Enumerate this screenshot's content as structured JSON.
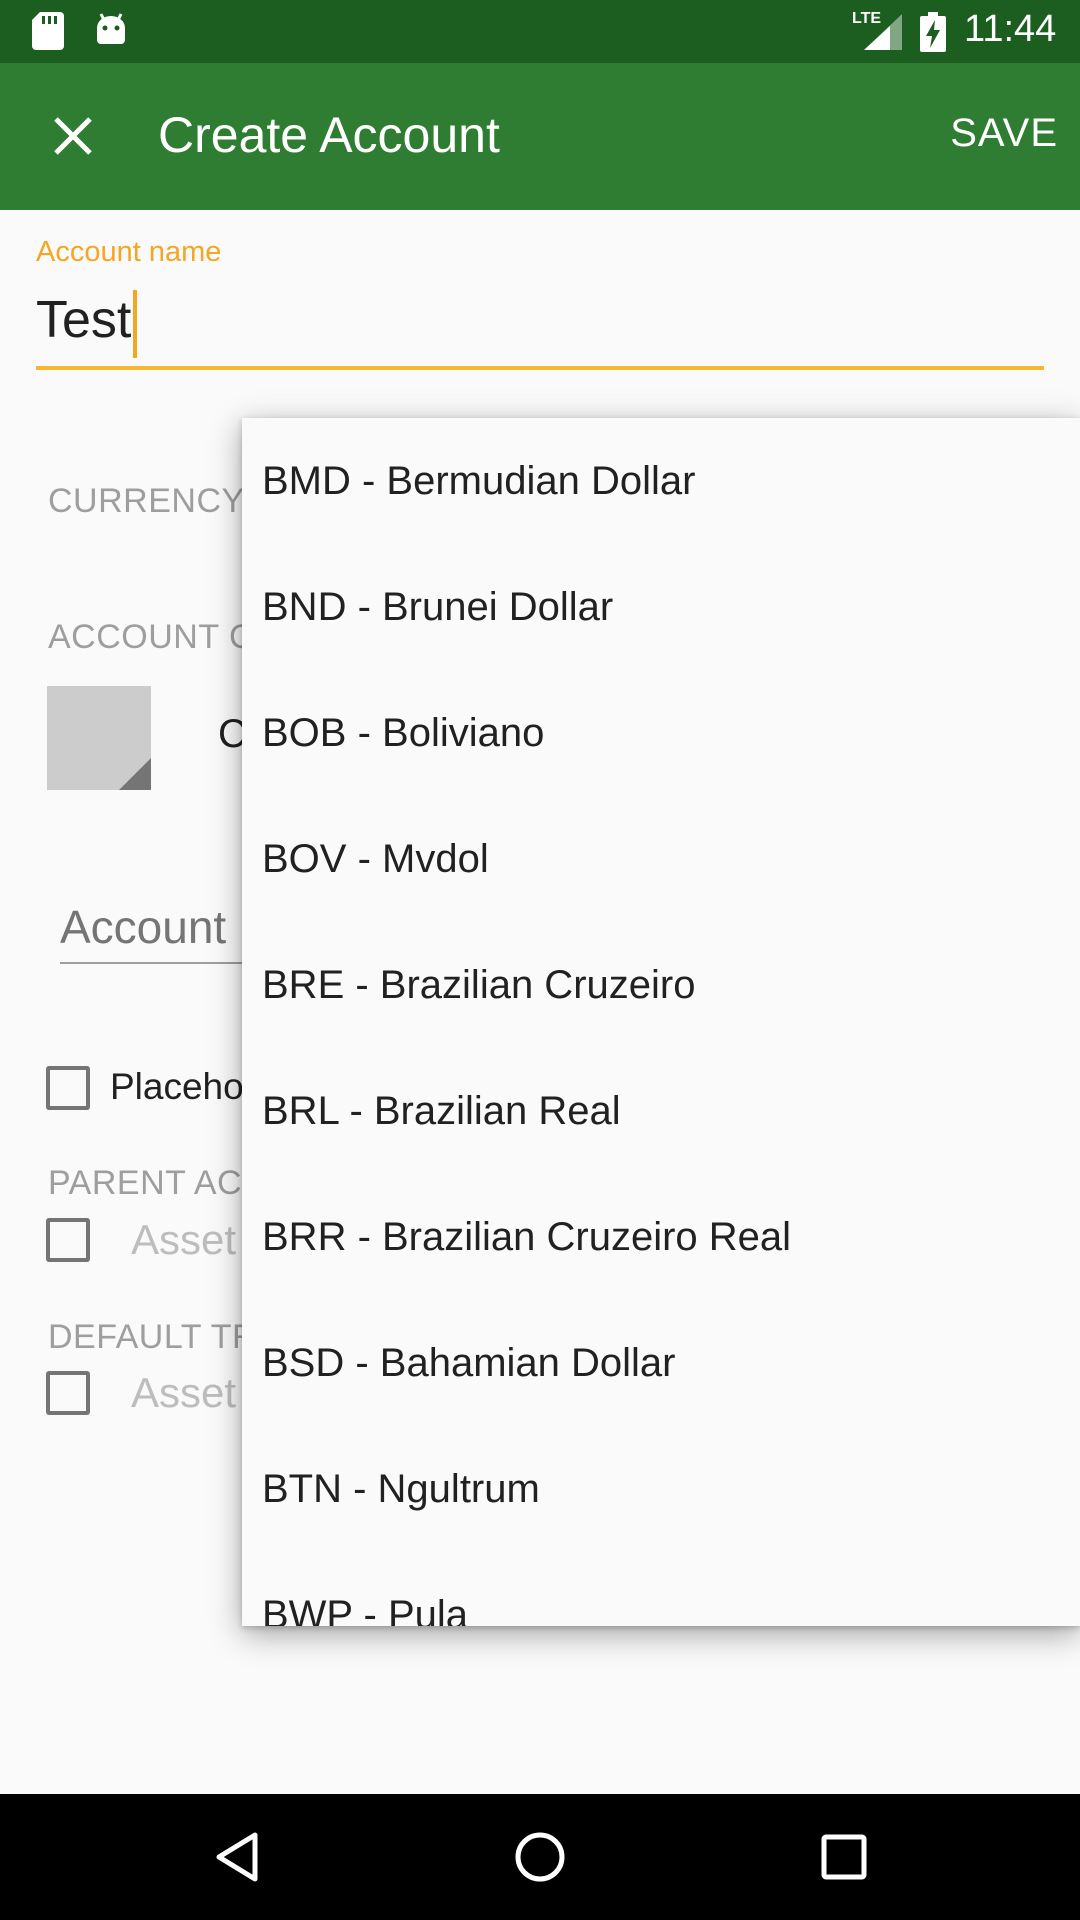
{
  "status_bar": {
    "time": "11:44",
    "network": "LTE",
    "icons": [
      "sd-card-icon",
      "android-icon",
      "signal-icon",
      "battery-charging-icon"
    ]
  },
  "toolbar": {
    "title": "Create Account",
    "save_label": "SAVE",
    "close_icon": "close-icon"
  },
  "form": {
    "account_name_label": "Account name",
    "account_name_value": "Test",
    "currency_label": "CURRENCY",
    "account_color_label": "ACCOUNT C",
    "color_text": "C",
    "description_placeholder": "Account",
    "placeholder_label": "Placeho",
    "parent_account_label": "PARENT AC",
    "parent_account_value": "Asset",
    "default_transfer_label": "DEFAULT TR",
    "default_transfer_value": "Asset"
  },
  "currency_dropdown": {
    "items": [
      "BMD - Bermudian Dollar",
      "BND - Brunei Dollar",
      "BOB - Boliviano",
      "BOV - Mvdol",
      "BRE - Brazilian Cruzeiro",
      "BRL - Brazilian Real",
      "BRR - Brazilian Cruzeiro Real",
      "BSD - Bahamian Dollar",
      "BTN - Ngultrum",
      "BWP - Pula"
    ]
  },
  "nav_bar": {
    "buttons": [
      "back-icon",
      "home-icon",
      "recents-icon"
    ]
  },
  "colors": {
    "status_bar": "#1b5e20",
    "toolbar": "#2e7d32",
    "accent": "#f5a623"
  }
}
